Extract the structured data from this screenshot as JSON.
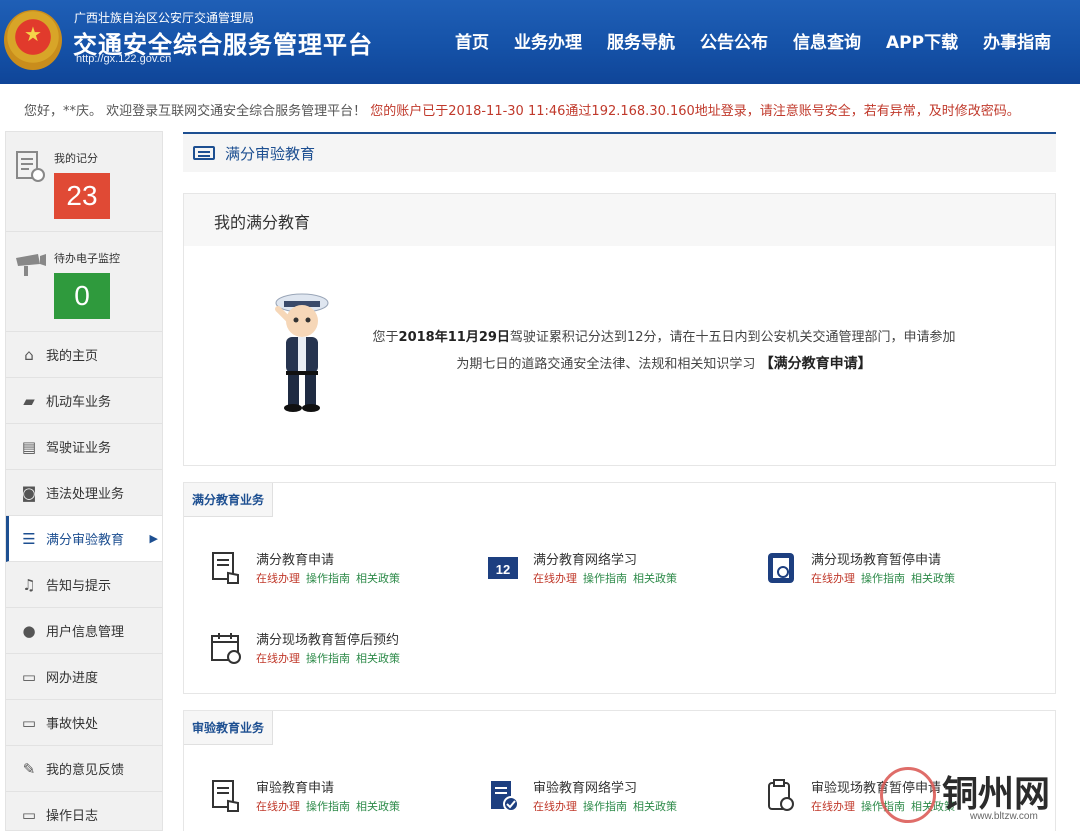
{
  "header": {
    "org": "广西壮族自治区公安厅交通管理局",
    "title": "交通安全综合服务管理平台",
    "url": "http://gx.122.gov.cn",
    "nav": [
      "首页",
      "业务办理",
      "服务导航",
      "公告公布",
      "信息查询",
      "APP下载",
      "办事指南"
    ]
  },
  "welcome": {
    "greeting": "您好，**庆。 欢迎登录互联网交通安全综合服务管理平台！",
    "login_info": "您的账户已于2018-11-30 11:46通过192.168.30.160地址登录，请注意账号安全，若有异常，及时修改密码。"
  },
  "sidebar": {
    "score": {
      "label": "我的记分",
      "value": "23"
    },
    "monitor": {
      "label": "待办电子监控",
      "value": "0"
    },
    "items": [
      {
        "label": "我的主页",
        "icon": "home-icon"
      },
      {
        "label": "机动车业务",
        "icon": "truck-icon"
      },
      {
        "label": "驾驶证业务",
        "icon": "license-card-icon"
      },
      {
        "label": "违法处理业务",
        "icon": "camera-icon"
      },
      {
        "label": "满分审验教育",
        "icon": "list-icon"
      },
      {
        "label": "告知与提示",
        "icon": "bell-icon"
      },
      {
        "label": "用户信息管理",
        "icon": "user-icon"
      },
      {
        "label": "网办进度",
        "icon": "progress-icon"
      },
      {
        "label": "事故快处",
        "icon": "accident-icon"
      },
      {
        "label": "我的意见反馈",
        "icon": "feedback-icon"
      },
      {
        "label": "操作日志",
        "icon": "log-icon"
      }
    ]
  },
  "breadcrumb": {
    "label": "满分审验教育"
  },
  "education": {
    "title": "我的满分教育",
    "notice_prefix": "您于",
    "notice_date": "2018年11月29日",
    "notice_mid": "驾驶证累积记分达到12分，请在十五日内到公安机关交通管理部门，申请参加",
    "notice_line2": "为期七日的道路交通安全法律、法规和相关知识学习",
    "apply_link": "【满分教育申请】"
  },
  "full_score_services": {
    "title": "满分教育业务",
    "items": [
      {
        "name": "满分教育申请",
        "icon": "form-hand-icon"
      },
      {
        "name": "满分教育网络学习",
        "icon": "online-study-icon"
      },
      {
        "name": "满分现场教育暂停申请",
        "icon": "pause-doc-icon"
      },
      {
        "name": "满分现场教育暂停后预约",
        "icon": "calendar-appointment-icon"
      }
    ]
  },
  "review_services": {
    "title": "审验教育业务",
    "items": [
      {
        "name": "审验教育申请",
        "icon": "form-hand-icon"
      },
      {
        "name": "审验教育网络学习",
        "icon": "doc-check-icon"
      },
      {
        "name": "审验现场教育暂停申请",
        "icon": "clipboard-pause-icon"
      }
    ]
  },
  "links": {
    "online": "在线办理",
    "guide": "操作指南",
    "policy": "相关政策"
  },
  "watermark": {
    "text": "铜州网",
    "url": "www.bltzw.com"
  }
}
